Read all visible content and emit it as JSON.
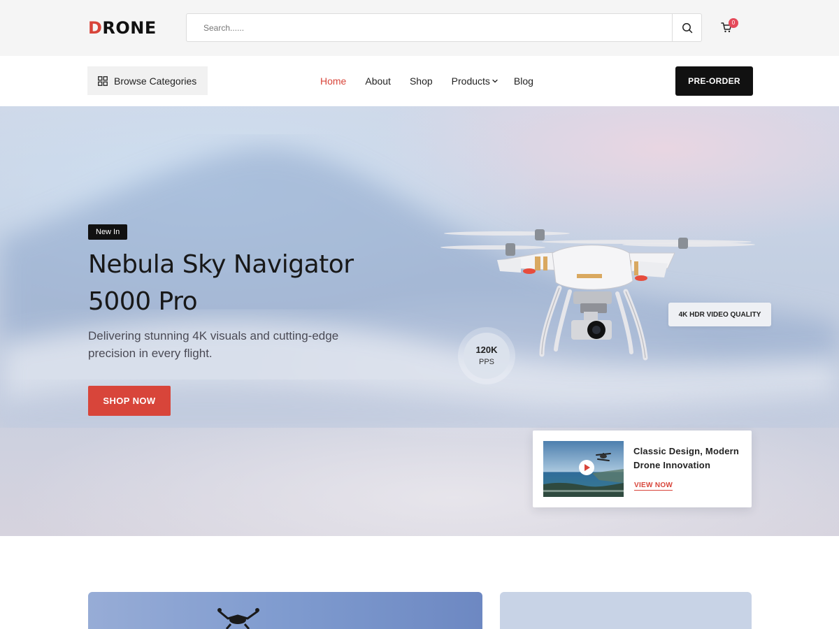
{
  "header": {
    "logo_first": "D",
    "logo_rest": "RONE",
    "search_placeholder": "Search......",
    "cart_count": "0"
  },
  "nav": {
    "browse_label": "Browse Categories",
    "items": [
      {
        "label": "Home",
        "active": true
      },
      {
        "label": "About"
      },
      {
        "label": "Shop"
      },
      {
        "label": "Products"
      },
      {
        "label": "Blog"
      }
    ],
    "preorder_label": "PRE-ORDER"
  },
  "hero": {
    "badge": "New In",
    "title": "Nebula Sky Navigator 5000 Pro",
    "subtitle": "Delivering stunning 4K visuals and cutting-edge precision in every flight.",
    "cta_label": "SHOP NOW",
    "stat_value": "120K",
    "stat_unit": "PPS",
    "feature_tag": "4K HDR VIDEO QUALITY",
    "promo": {
      "title": "Classic Design, Modern Drone Innovation",
      "link_label": "VIEW NOW"
    }
  },
  "icons": {
    "search": "search-icon",
    "cart": "cart-icon",
    "grid": "grid-icon",
    "chevron": "chevron-down-icon",
    "play": "play-icon"
  },
  "colors": {
    "accent": "#d8453a",
    "dark": "#111111",
    "badge": "#e54a5a"
  }
}
